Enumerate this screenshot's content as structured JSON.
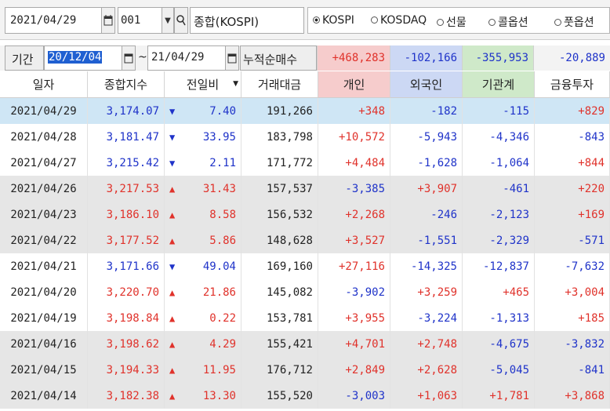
{
  "toolbar": {
    "date": "2021/04/29",
    "code": "001",
    "name": "종합(KOSPI)"
  },
  "market_options": [
    {
      "label": "KOSPI",
      "selected": true
    },
    {
      "label": "KOSDAQ",
      "selected": false
    },
    {
      "label": "선물",
      "selected": false
    },
    {
      "label": "콜옵션",
      "selected": false
    },
    {
      "label": "풋옵션",
      "selected": false
    }
  ],
  "period": {
    "label": "기간",
    "start": "20/12/04",
    "separator": "~",
    "end": "21/04/29",
    "cumulative_label": "누적순매수"
  },
  "summary": [
    {
      "value": "+468,283",
      "bg": "#f6cccc",
      "color": "#e0322b"
    },
    {
      "value": "-102,166",
      "bg": "#ccd8f4",
      "color": "#1f33c9"
    },
    {
      "value": "-355,953",
      "bg": "#cfe9c9",
      "color": "#1f33c9"
    },
    {
      "value": "-20,889",
      "bg": "#f3f3f3",
      "color": "#1f33c9"
    }
  ],
  "columns": [
    {
      "label": "일자",
      "bg": "#ffffff"
    },
    {
      "label": "종합지수",
      "bg": "#ffffff"
    },
    {
      "label": "전일비",
      "bg": "#ffffff"
    },
    {
      "label": "거래대금",
      "bg": "#ffffff"
    },
    {
      "label": "개인",
      "bg": "#f6cccc"
    },
    {
      "label": "외국인",
      "bg": "#ccd8f4"
    },
    {
      "label": "기관계",
      "bg": "#cfe9c9"
    },
    {
      "label": "금융투자",
      "bg": "#ffffff"
    }
  ],
  "rows": [
    {
      "date": "2021/04/29",
      "index": "3,174.07",
      "dir": "down",
      "change": "7.40",
      "amount": "191,266",
      "indiv": "+348",
      "foreign": "-182",
      "inst": "-115",
      "fin": "+829"
    },
    {
      "date": "2021/04/28",
      "index": "3,181.47",
      "dir": "down",
      "change": "33.95",
      "amount": "183,798",
      "indiv": "+10,572",
      "foreign": "-5,943",
      "inst": "-4,346",
      "fin": "-843"
    },
    {
      "date": "2021/04/27",
      "index": "3,215.42",
      "dir": "down",
      "change": "2.11",
      "amount": "171,772",
      "indiv": "+4,484",
      "foreign": "-1,628",
      "inst": "-1,064",
      "fin": "+844"
    },
    {
      "date": "2021/04/26",
      "index": "3,217.53",
      "dir": "up",
      "change": "31.43",
      "amount": "157,537",
      "indiv": "-3,385",
      "foreign": "+3,907",
      "inst": "-461",
      "fin": "+220"
    },
    {
      "date": "2021/04/23",
      "index": "3,186.10",
      "dir": "up",
      "change": "8.58",
      "amount": "156,532",
      "indiv": "+2,268",
      "foreign": "-246",
      "inst": "-2,123",
      "fin": "+169"
    },
    {
      "date": "2021/04/22",
      "index": "3,177.52",
      "dir": "up",
      "change": "5.86",
      "amount": "148,628",
      "indiv": "+3,527",
      "foreign": "-1,551",
      "inst": "-2,329",
      "fin": "-571"
    },
    {
      "date": "2021/04/21",
      "index": "3,171.66",
      "dir": "down",
      "change": "49.04",
      "amount": "169,160",
      "indiv": "+27,116",
      "foreign": "-14,325",
      "inst": "-12,837",
      "fin": "-7,632"
    },
    {
      "date": "2021/04/20",
      "index": "3,220.70",
      "dir": "up",
      "change": "21.86",
      "amount": "145,082",
      "indiv": "-3,902",
      "foreign": "+3,259",
      "inst": "+465",
      "fin": "+3,004"
    },
    {
      "date": "2021/04/19",
      "index": "3,198.84",
      "dir": "up",
      "change": "0.22",
      "amount": "153,781",
      "indiv": "+3,955",
      "foreign": "-3,224",
      "inst": "-1,313",
      "fin": "+185"
    },
    {
      "date": "2021/04/16",
      "index": "3,198.62",
      "dir": "up",
      "change": "4.29",
      "amount": "155,421",
      "indiv": "+4,701",
      "foreign": "+2,748",
      "inst": "-4,675",
      "fin": "-3,832"
    },
    {
      "date": "2021/04/15",
      "index": "3,194.33",
      "dir": "up",
      "change": "11.95",
      "amount": "176,712",
      "indiv": "+2,849",
      "foreign": "+2,628",
      "inst": "-5,045",
      "fin": "-841"
    },
    {
      "date": "2021/04/14",
      "index": "3,182.38",
      "dir": "up",
      "change": "13.30",
      "amount": "155,520",
      "indiv": "-3,003",
      "foreign": "+1,063",
      "inst": "+1,781",
      "fin": "+3,868"
    }
  ],
  "row_backgrounds": {
    "selected": "#cfe6f5",
    "white": "#ffffff",
    "gray": "#e6e6e6"
  },
  "up_arrow": "▲",
  "down_arrow": "▼",
  "icons": {
    "calendar": "calendar-icon",
    "search": "search-icon",
    "dropdown": "chevron-down-icon"
  }
}
